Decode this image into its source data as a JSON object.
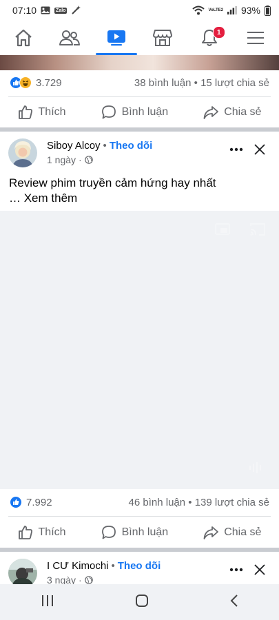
{
  "status_bar": {
    "time": "07:10",
    "zalo_label": "Zalo",
    "volte_label": "VoLTE2",
    "battery": "93%"
  },
  "nav": {
    "items": [
      "home-icon",
      "friends-icon",
      "watch-icon",
      "marketplace-icon",
      "notifications-icon",
      "menu-icon"
    ],
    "active": "watch-icon",
    "notification_badge": "1",
    "accent_color": "#1877f2",
    "badge_color": "#e41e3f"
  },
  "prev_post": {
    "reaction_count": "3.729",
    "comments": "38 bình luận",
    "shares": "15 lượt chia sẻ",
    "separator_dot": "•"
  },
  "actions": {
    "like": "Thích",
    "comment": "Bình luận",
    "share": "Chia sẻ"
  },
  "post1": {
    "author": "Siboy Alcoy",
    "separator_dot": "•",
    "follow": "Theo dõi",
    "time": "1 ngày",
    "meta_dot": "·",
    "text": "Review phim truyền cảm hứng hay nhất",
    "see_more": "… Xem thêm",
    "reaction_count": "7.992",
    "comments": "46 bình luận",
    "shares": "139 lượt chia sẻ"
  },
  "post2": {
    "author": "I CƯ Kimochi",
    "separator_dot": "•",
    "follow": "Theo dõi",
    "time": "3 ngày",
    "meta_dot": "·"
  },
  "system_nav": [
    "recents-icon",
    "home-button-icon",
    "back-icon"
  ]
}
